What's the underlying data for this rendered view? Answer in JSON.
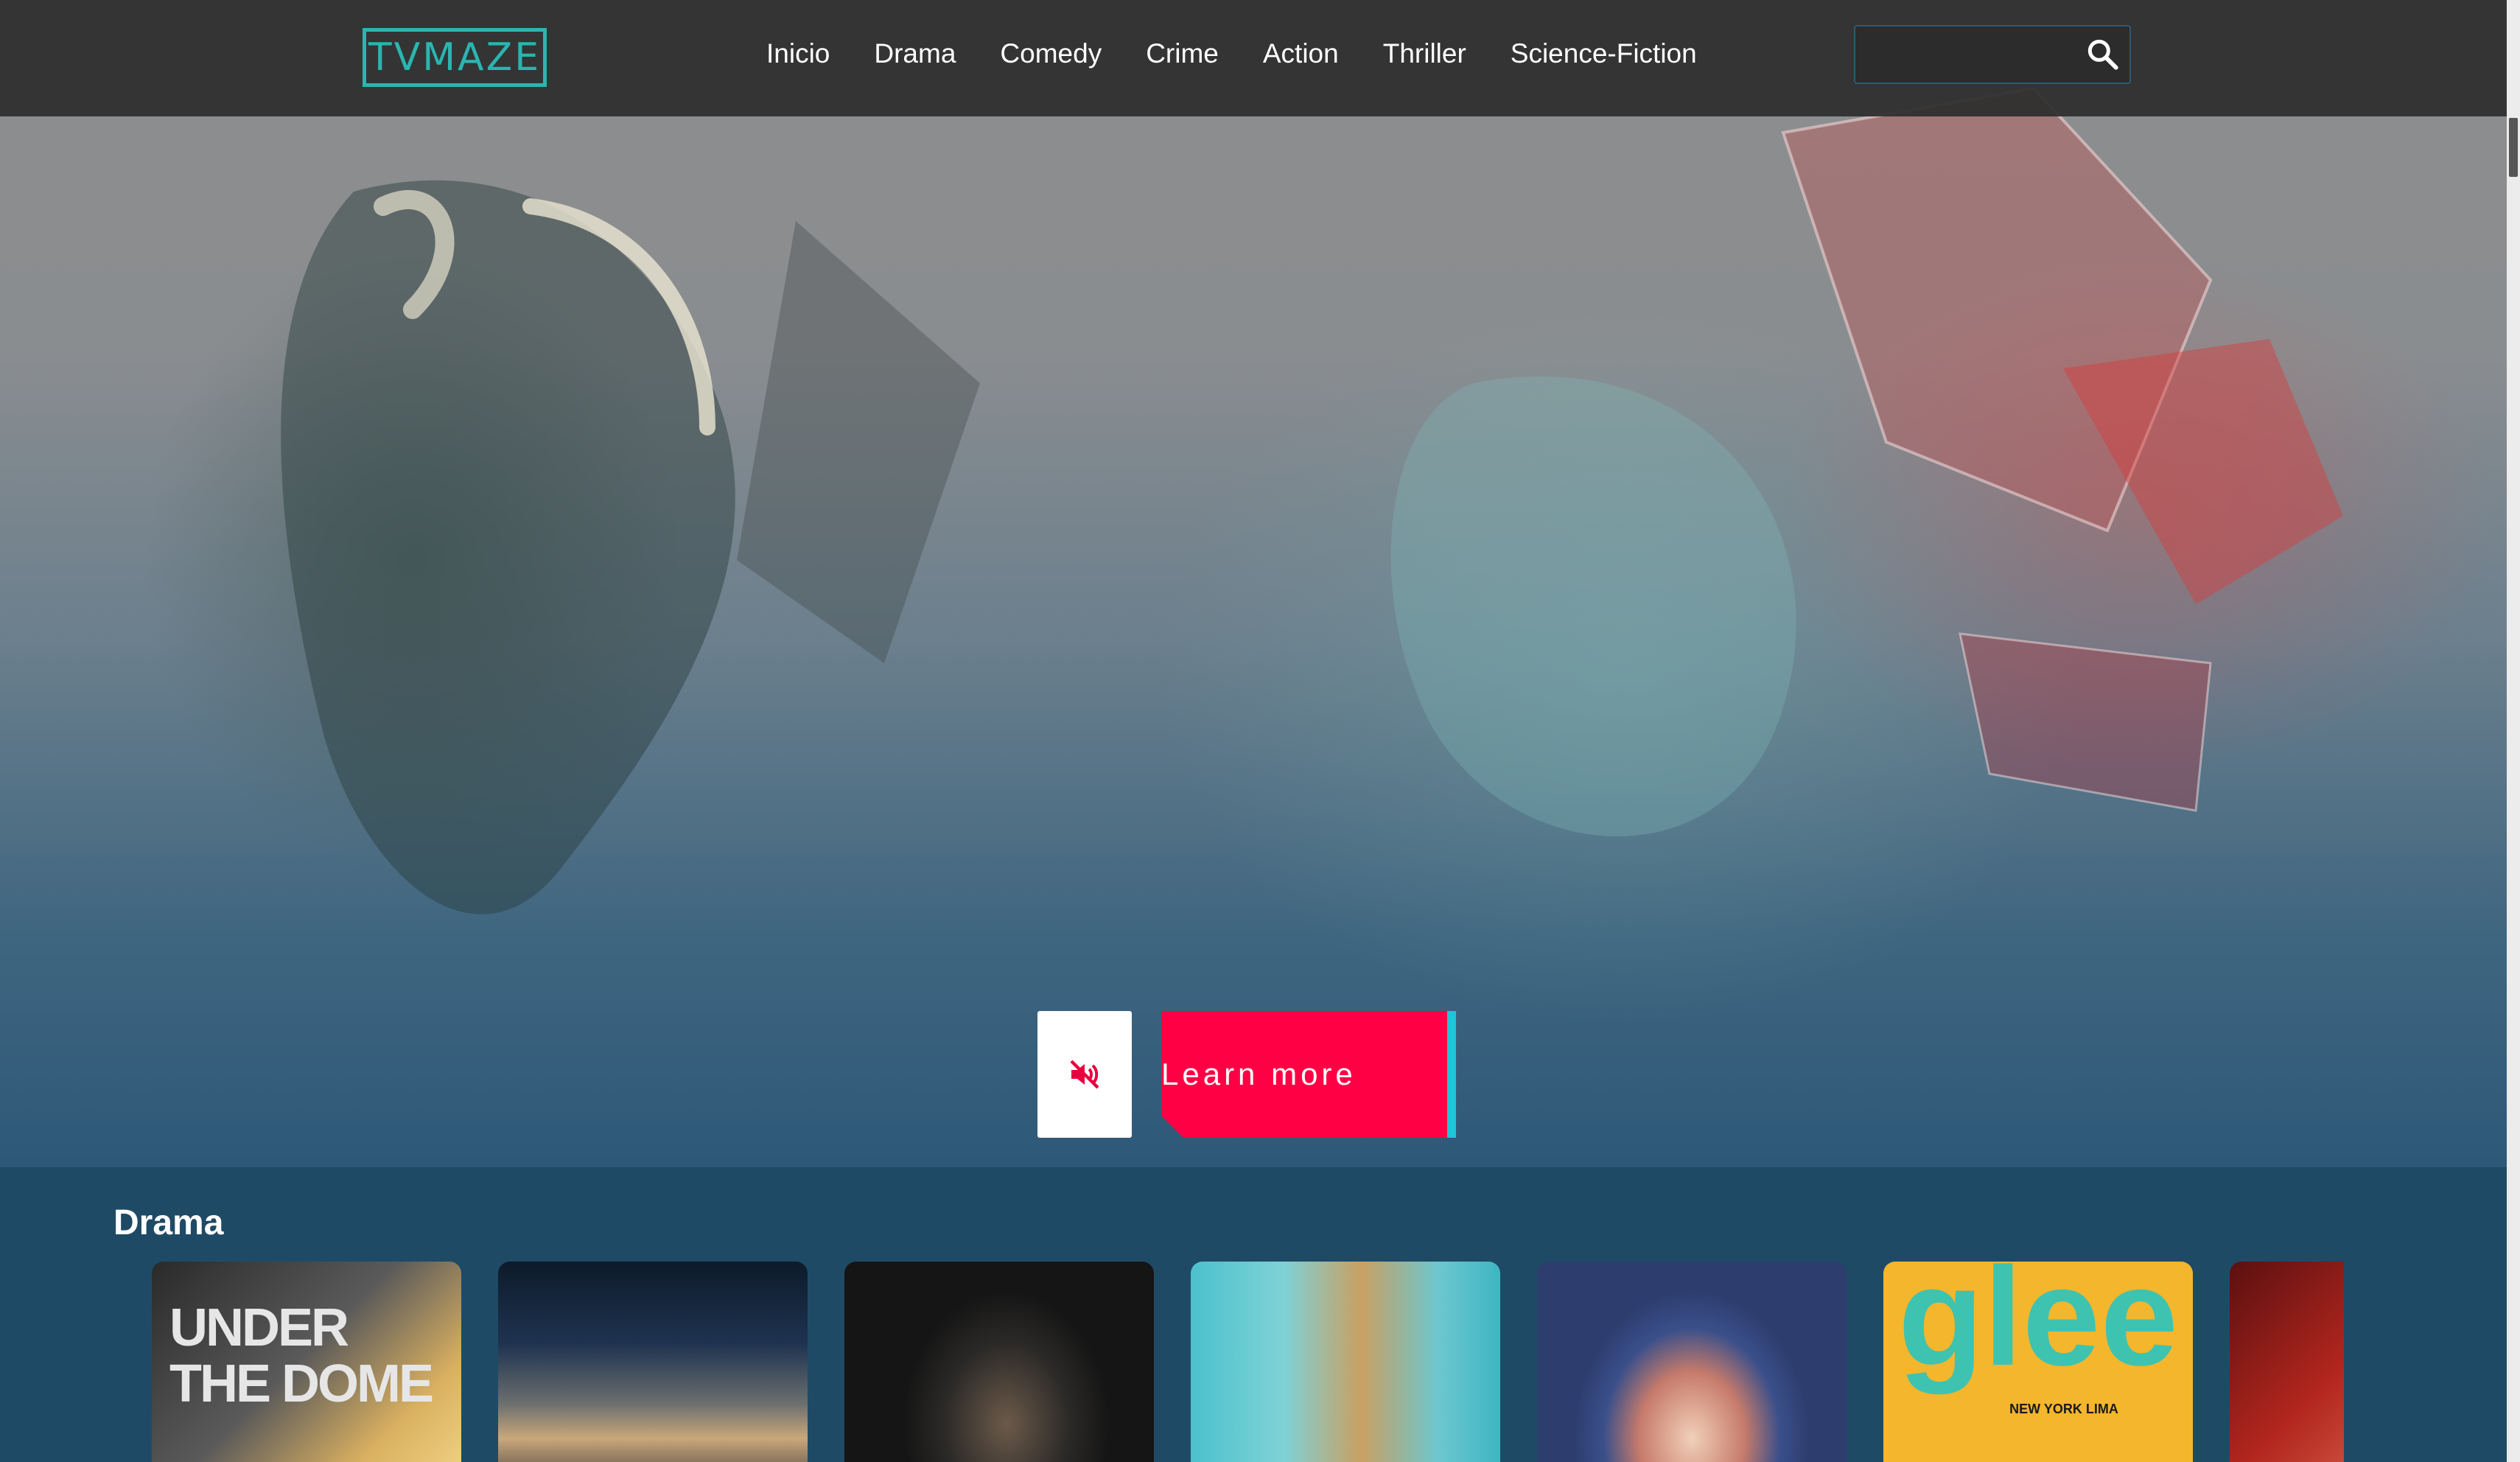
{
  "header": {
    "logo_text": "TVMAZE",
    "nav_items": [
      "Inicio",
      "Drama",
      "Comedy",
      "Crime",
      "Action",
      "Thriller",
      "Science-Fiction"
    ],
    "search": {
      "value": "",
      "placeholder": ""
    }
  },
  "hero": {
    "mute_icon": "volume-off-icon",
    "learn_more_label": "Learn more"
  },
  "drama_row": {
    "title": "Drama",
    "posters": [
      {
        "title": "UNDER THE DOME"
      },
      {
        "title": ""
      },
      {
        "title": ""
      },
      {
        "title": ""
      },
      {
        "title": ""
      },
      {
        "title": "glee",
        "subtitle": "NEW YORK LIMA"
      },
      {
        "title": ""
      }
    ]
  },
  "colors": {
    "accent": "#2bb5b0",
    "cta": "#ff0044",
    "cta_edge": "#1dc6d8",
    "navbar": "#2d2d2d",
    "section_bg": "#1f4a66"
  }
}
